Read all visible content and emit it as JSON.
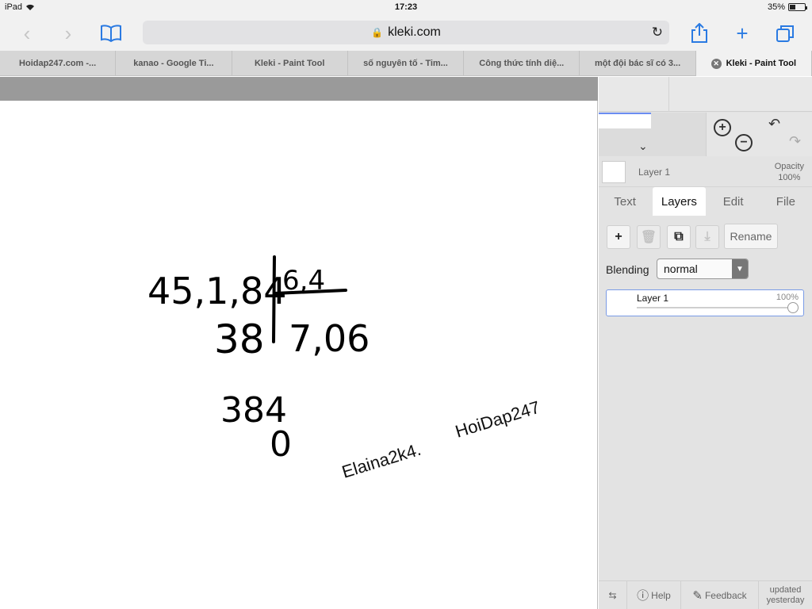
{
  "status_bar": {
    "device": "iPad",
    "time": "17:23",
    "battery": "35%"
  },
  "browser": {
    "url": "kleki.com",
    "tabs": [
      {
        "label": "Hoidap247.com -..."
      },
      {
        "label": "kanao - Google Ti..."
      },
      {
        "label": "Kleki - Paint Tool"
      },
      {
        "label": "số nguyên tố - Tim..."
      },
      {
        "label": "Công thức tính diệ..."
      },
      {
        "label": "một đội bác sĩ có 3..."
      },
      {
        "label": "Kleki - Paint Tool",
        "active": true
      }
    ]
  },
  "canvas": {
    "handwriting": {
      "line1": "45,1,84",
      "divisor": "6,4",
      "line2": "38",
      "quotient": "7,06",
      "line3": "384",
      "line4": "0"
    },
    "text_stamps": [
      "Elaina2k4.",
      "HoiDap247"
    ]
  },
  "panel": {
    "current_layer": "Layer 1",
    "opacity_label": "Opacity",
    "opacity_value": "100%",
    "tabs": [
      "Text",
      "Layers",
      "Edit",
      "File"
    ],
    "active_tab": "Layers",
    "rename_label": "Rename",
    "blending_label": "Blending",
    "blending_value": "normal",
    "layers": [
      {
        "name": "Layer 1",
        "opacity": "100%"
      }
    ],
    "footer": {
      "help": "Help",
      "feedback": "Feedback",
      "updated": "updated yesterday"
    }
  },
  "colors": {
    "accent": "#2a7ae2",
    "selection": "#7a9be6",
    "canvas_bg": "#ffffff",
    "chrome_gray": "#9a9a9a"
  }
}
